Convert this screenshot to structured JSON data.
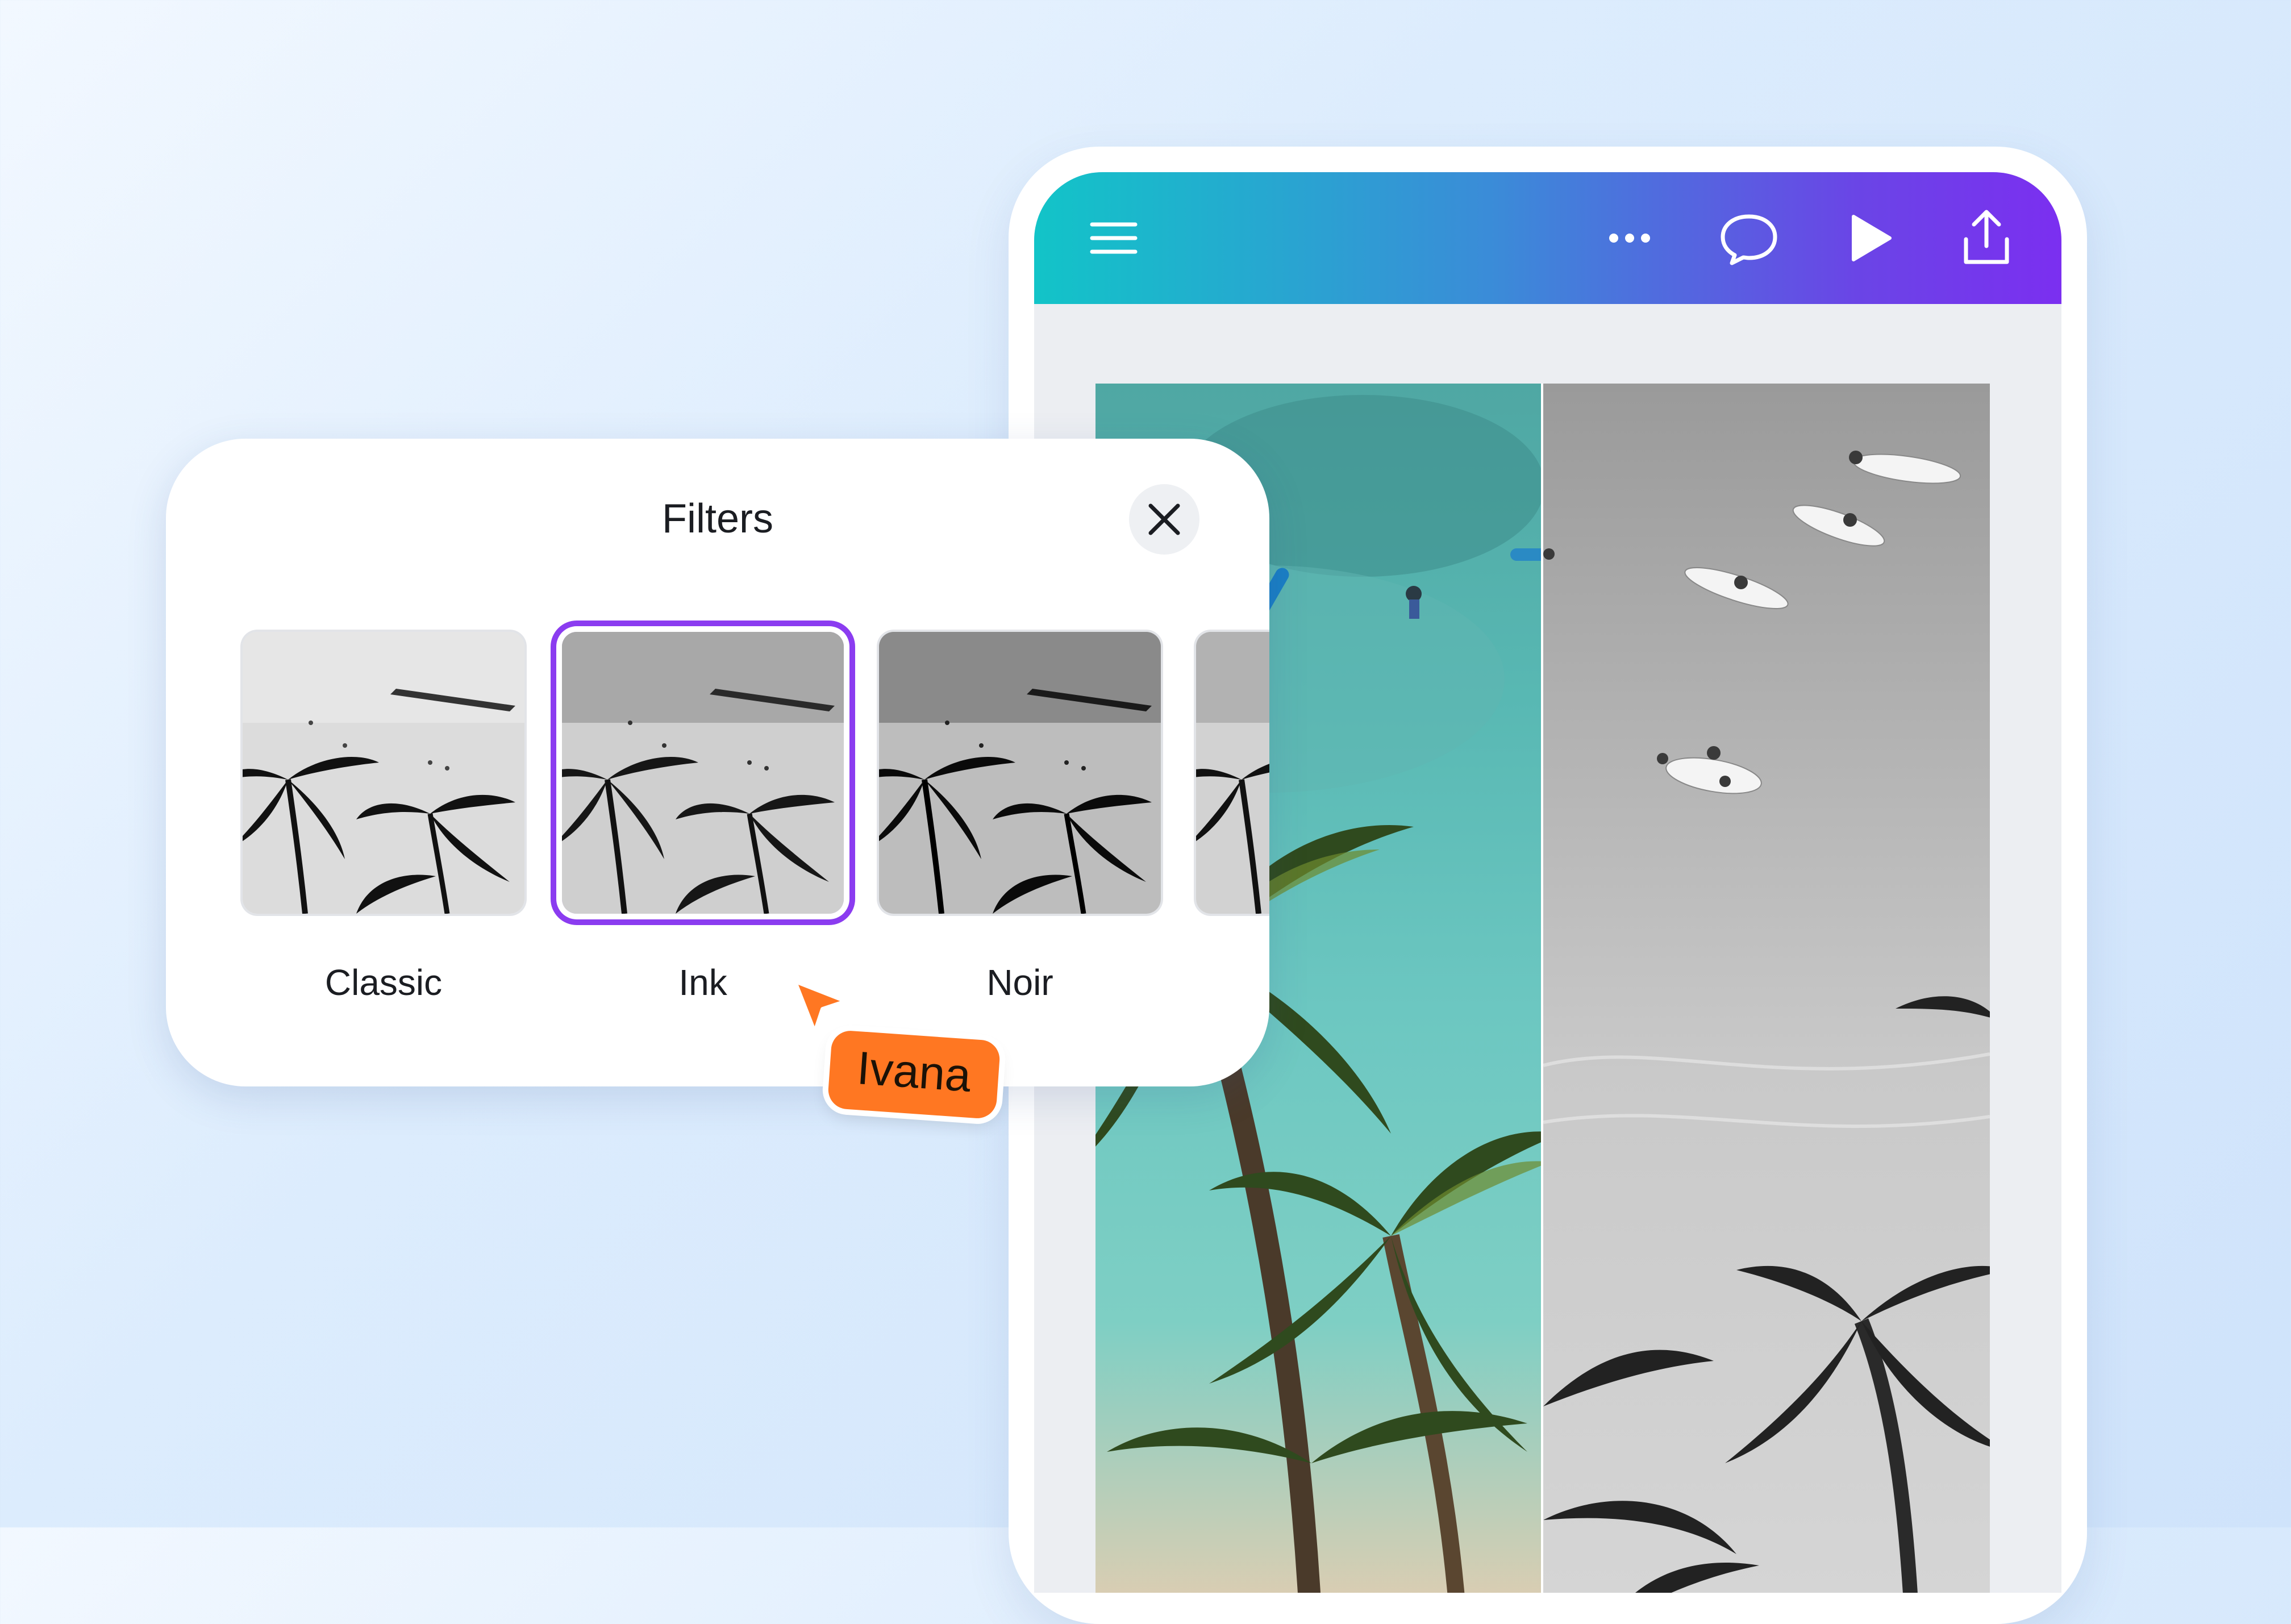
{
  "colors": {
    "toolbar_gradient": [
      "#12c4c8",
      "#3b8bd8",
      "#6a45e6",
      "#7b2ff0"
    ],
    "selection": "#8b3cf0",
    "collaborator": "#ff7722",
    "background": "#dcecfd"
  },
  "editor": {
    "toolbar_icons": [
      "menu-icon",
      "more-options-icon",
      "comment-icon",
      "play-icon",
      "share-icon"
    ],
    "canvas": {
      "left_photo": "original color beach photo",
      "right_photo": "same photo with black-and-white filter"
    }
  },
  "filters_panel": {
    "title": "Filters",
    "close_icon": "close-icon",
    "selected": "Ink",
    "items": [
      {
        "label": "Classic"
      },
      {
        "label": "Ink"
      },
      {
        "label": "Noir"
      },
      {
        "label": ""
      }
    ]
  },
  "collaborator": {
    "name": "Ivana",
    "cursor_icon": "pointer-cursor-icon"
  }
}
